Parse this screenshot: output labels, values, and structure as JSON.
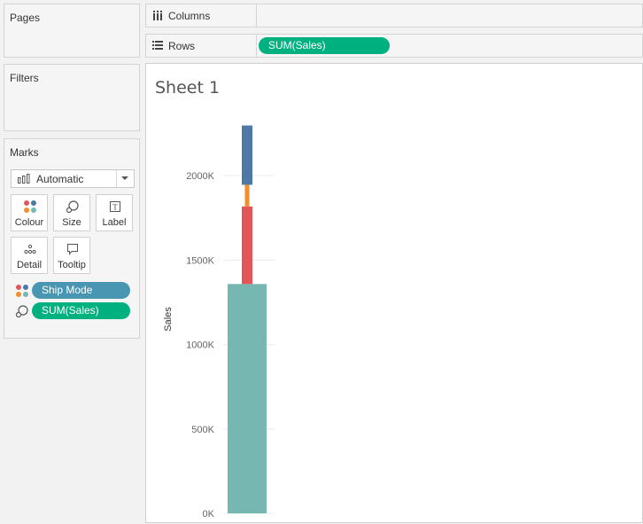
{
  "cards": {
    "pages_title": "Pages",
    "filters_title": "Filters",
    "marks_title": "Marks"
  },
  "marks": {
    "mark_type": "Automatic",
    "buttons": [
      {
        "label": "Colour",
        "icon": "colour-dots-icon"
      },
      {
        "label": "Size",
        "icon": "size-icon"
      },
      {
        "label": "Label",
        "icon": "label-icon"
      },
      {
        "label": "Detail",
        "icon": "detail-dots-icon"
      },
      {
        "label": "Tooltip",
        "icon": "tooltip-icon"
      }
    ],
    "fields": [
      {
        "label": "Ship Mode",
        "encoding": "colour",
        "color": "#4996b2"
      },
      {
        "label": "SUM(Sales)",
        "encoding": "size",
        "color": "#00b180"
      }
    ]
  },
  "shelves": {
    "columns_label": "Columns",
    "rows_label": "Rows",
    "rows_pill": "SUM(Sales)"
  },
  "sheet": {
    "title": "Sheet 1"
  },
  "chart_data": {
    "type": "bar",
    "stacked": true,
    "ylabel": "Sales",
    "ylim": [
      0,
      2300000
    ],
    "yticks": [
      0,
      500000,
      1000000,
      1500000,
      2000000
    ],
    "ytick_labels": [
      "0K",
      "500K",
      "1000K",
      "1500K",
      "2000K"
    ],
    "grid": true,
    "series": [
      {
        "values": [
          1358216
        ],
        "color": "#76b7b2"
      },
      {
        "values": [
          459194
        ],
        "color": "#e15759"
      },
      {
        "values": [
          128364
        ],
        "color": "#f28e2b"
      },
      {
        "values": [
          351428
        ],
        "color": "#4e79a7"
      }
    ]
  }
}
